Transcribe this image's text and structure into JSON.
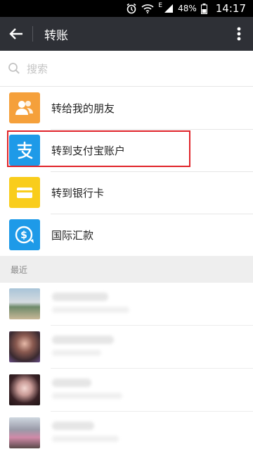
{
  "status_bar": {
    "battery_percent": "48%",
    "network_label": "E",
    "time": "14:17"
  },
  "header": {
    "title": "转账"
  },
  "search": {
    "placeholder": "搜索"
  },
  "transfer_options": [
    {
      "label": "转给我的朋友",
      "icon": "friends-icon",
      "color": "#f5a03b"
    },
    {
      "label": "转到支付宝账户",
      "icon": "alipay-icon",
      "color": "#1e9ae8"
    },
    {
      "label": "转到银行卡",
      "icon": "bank-card-icon",
      "color": "#f9cd1c"
    },
    {
      "label": "国际汇款",
      "icon": "international-remittance-icon",
      "color": "#1e9ae8"
    }
  ],
  "highlighted_option": "转到支付宝账户",
  "recent": {
    "header": "最近",
    "contacts_visible": 4
  },
  "colors": {
    "app_bar": "#2e3036",
    "highlight_border": "#e0242a",
    "section_bg": "#eeeeee"
  }
}
